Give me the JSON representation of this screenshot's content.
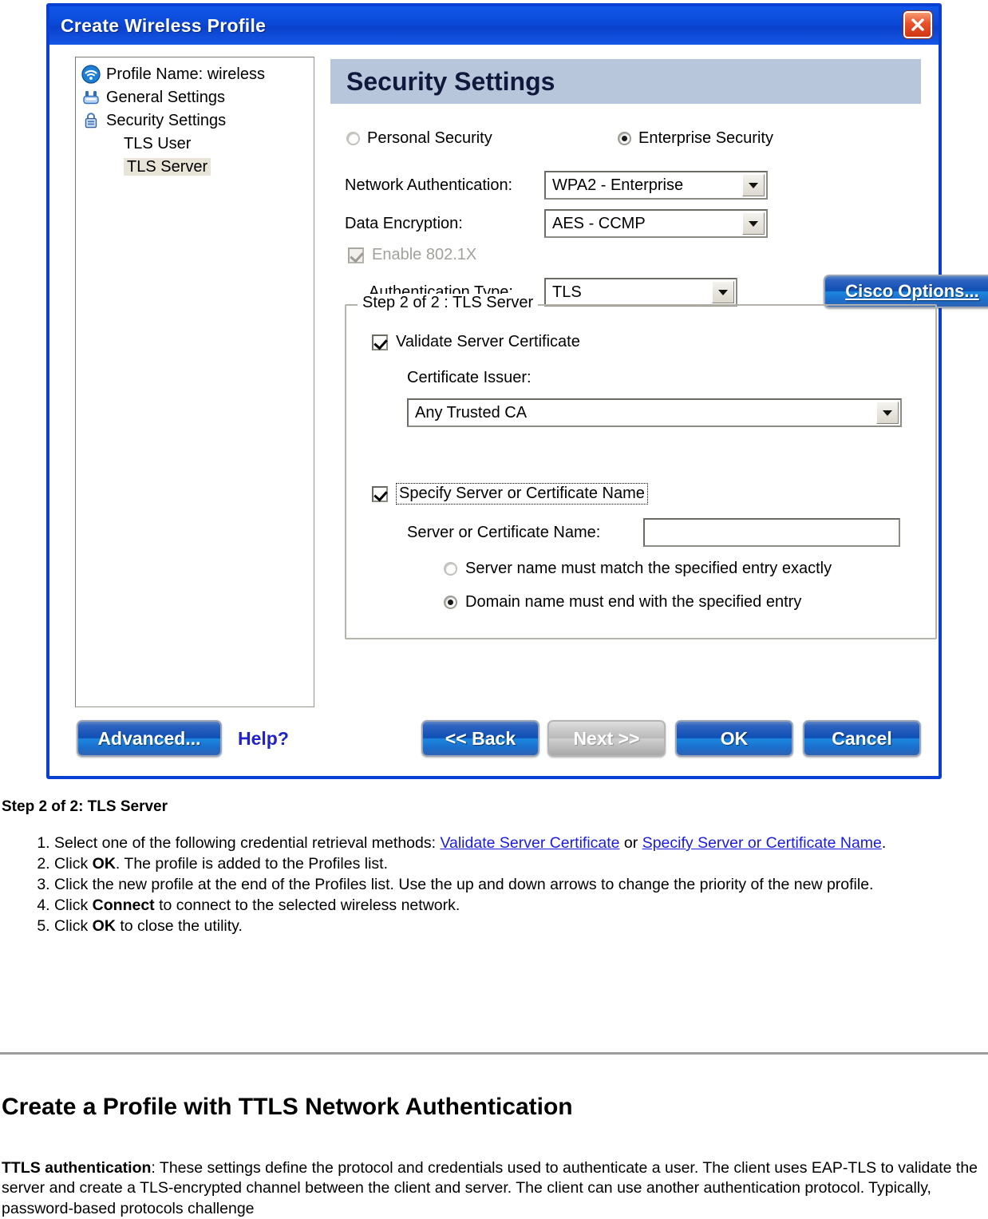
{
  "dialog": {
    "title": "Create Wireless Profile",
    "close_icon": "close-icon",
    "tree": {
      "items": [
        {
          "label": "Profile Name: wireless",
          "icon": "wireless-signal-icon",
          "indent": false,
          "selected": false
        },
        {
          "label": "General Settings",
          "icon": "general-settings-icon",
          "indent": false,
          "selected": false
        },
        {
          "label": "Security Settings",
          "icon": "lock-icon",
          "indent": false,
          "selected": false
        },
        {
          "label": "TLS User",
          "icon": "",
          "indent": true,
          "selected": false
        },
        {
          "label": "TLS Server",
          "icon": "",
          "indent": true,
          "selected": true
        }
      ]
    },
    "pane": {
      "header": "Security Settings",
      "security_mode": {
        "personal_label": "Personal Security",
        "personal_selected": false,
        "enterprise_label": "Enterprise Security",
        "enterprise_selected": true
      },
      "network_auth": {
        "label": "Network Authentication:",
        "value": "WPA2 - Enterprise"
      },
      "data_encryption": {
        "label": "Data Encryption:",
        "value": "AES - CCMP"
      },
      "enable_8021x": {
        "label": "Enable 802.1X",
        "checked": true,
        "disabled": true
      },
      "auth_type": {
        "label": "Authentication Type:",
        "value": "TLS"
      },
      "cisco_options_button": "Cisco Options...",
      "groupbox": {
        "title": "Step 2 of 2 : TLS Server",
        "validate_server_certificate": {
          "label": "Validate Server Certificate",
          "checked": true
        },
        "certificate_issuer": {
          "label": "Certificate Issuer:",
          "value": "Any Trusted CA"
        },
        "specify_server_name": {
          "label": "Specify Server or Certificate Name",
          "checked": true
        },
        "server_name_field": {
          "label": "Server or Certificate Name:",
          "value": "",
          "placeholder": ""
        },
        "match_options": [
          {
            "label": "Server name must match the specified entry exactly",
            "selected": false
          },
          {
            "label": "Domain name must end with the specified entry",
            "selected": true
          }
        ]
      }
    },
    "buttons": {
      "advanced": "Advanced...",
      "help": "Help?",
      "back": "<< Back",
      "next": "Next >>",
      "next_disabled": true,
      "ok": "OK",
      "cancel": "Cancel"
    }
  },
  "document": {
    "step_heading": "Step 2 of 2: TLS Server",
    "steps": [
      {
        "prefix": "Select one of the following credential retrieval methods: ",
        "link1": "Validate Server Certificate",
        "middle": " or ",
        "link2": "Specify Server or Certificate Name",
        "suffix": "."
      },
      {
        "prefix": "Click ",
        "bold": "OK",
        "suffix": ". The profile is added to the Profiles list."
      },
      {
        "prefix": "Click the new profile at the end of the Profiles list. Use the up and down arrows to change the priority of the new profile.",
        "bold": "",
        "suffix": ""
      },
      {
        "prefix": "Click ",
        "bold": "Connect",
        "suffix": " to connect to the selected wireless network."
      },
      {
        "prefix": "Click ",
        "bold": "OK",
        "suffix": " to close the utility."
      }
    ],
    "section_title": "Create a Profile with TTLS Network Authentication",
    "paragraph_bold": "TTLS authentication",
    "paragraph_text": ": These settings define the protocol and credentials used to authenticate a user. The client uses EAP-TLS to validate the server and create a TLS-encrypted channel between the client and server. The client can use another authentication protocol. Typically, password-based protocols challenge"
  },
  "colors": {
    "title_blue": "#0b49d8",
    "border_blue": "#0a3fd4",
    "header_bar": "#b8c6dc",
    "link_blue": "#1b1bdd",
    "close_red": "#e8512a"
  }
}
